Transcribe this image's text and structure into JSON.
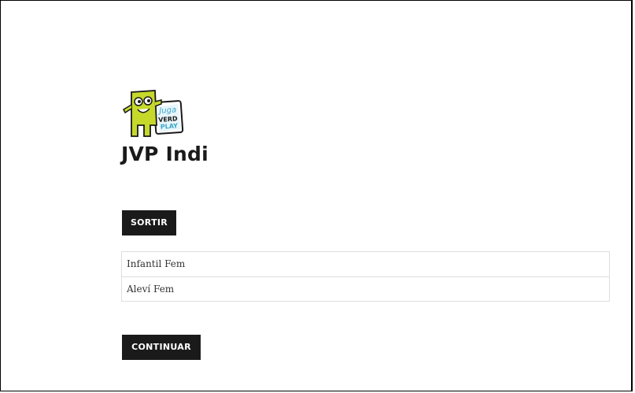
{
  "site": {
    "title": "JVP Indi",
    "logo_text": "Juga VERD PLAY"
  },
  "actions": {
    "sortir_label": "SORTIR",
    "continuar_label": "CONTINUAR"
  },
  "teams": [
    {
      "label": "Infantil Fem"
    },
    {
      "label": "Aleví Fem"
    }
  ],
  "colors": {
    "button_bg": "#1a1a1a",
    "button_text": "#ffffff",
    "logo_green": "#c6d92b",
    "logo_blue": "#3aa6c9"
  }
}
